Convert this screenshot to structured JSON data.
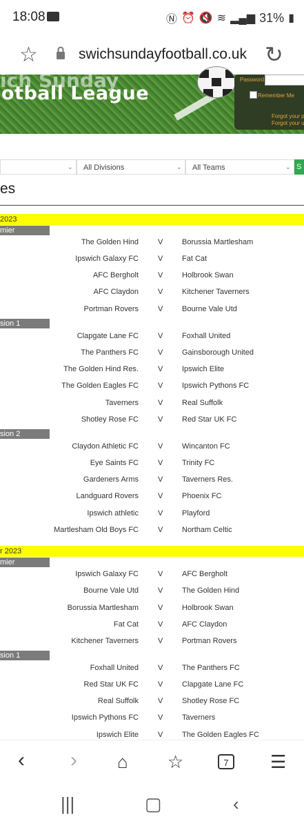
{
  "status_bar": {
    "time": "18:08",
    "battery": "31%"
  },
  "url_bar": {
    "url": "swichsundayfootball.co.uk"
  },
  "banner": {
    "title_top": "ich Sunday",
    "title": "otball League"
  },
  "login": {
    "password_label": "Password",
    "remember_label": "Remember Me",
    "forgot1": "Forgot your p",
    "forgot2": "Forgot your u"
  },
  "filters": {
    "divisions": "All Divisions",
    "teams": "All Teams",
    "go": "S"
  },
  "page_heading": "es",
  "sections": [
    {
      "date": "2023",
      "groups": [
        {
          "division": "mier",
          "fixtures": [
            {
              "home": "The Golden Hind",
              "away": "Borussia Martlesham"
            },
            {
              "home": "Ipswich Galaxy FC",
              "away": "Fat Cat"
            },
            {
              "home": "AFC Bergholt",
              "away": "Holbrook Swan"
            },
            {
              "home": "AFC Claydon",
              "away": "Kitchener Taverners"
            },
            {
              "home": "Portman Rovers",
              "away": "Bourne Vale Utd"
            }
          ]
        },
        {
          "division": "sion 1",
          "fixtures": [
            {
              "home": "Clapgate Lane FC",
              "away": "Foxhall United"
            },
            {
              "home": "The Panthers FC",
              "away": "Gainsborough United"
            },
            {
              "home": "The Golden Hind Res.",
              "away": "Ipswich Elite"
            },
            {
              "home": "The Golden Eagles FC",
              "away": "Ipswich Pythons FC"
            },
            {
              "home": "Taverners",
              "away": "Real Suffolk"
            },
            {
              "home": "Shotley Rose FC",
              "away": "Red Star UK FC"
            }
          ]
        },
        {
          "division": "sion 2",
          "fixtures": [
            {
              "home": "Claydon Athletic FC",
              "away": "Wincanton FC"
            },
            {
              "home": "Eye Saints FC",
              "away": "Trinity FC"
            },
            {
              "home": "Gardeners Arms",
              "away": "Taverners Res."
            },
            {
              "home": "Landguard Rovers",
              "away": "Phoenix FC"
            },
            {
              "home": "Ipswich athletic",
              "away": "Playford"
            },
            {
              "home": "Martlesham Old Boys FC",
              "away": "Northam Celtic"
            }
          ]
        }
      ]
    },
    {
      "date": "r 2023",
      "groups": [
        {
          "division": "mier",
          "fixtures": [
            {
              "home": "Ipswich Galaxy FC",
              "away": "AFC Bergholt"
            },
            {
              "home": "Bourne Vale Utd",
              "away": "The Golden Hind"
            },
            {
              "home": "Borussia Martlesham",
              "away": "Holbrook Swan"
            },
            {
              "home": "Fat Cat",
              "away": "AFC Claydon"
            },
            {
              "home": "Kitchener Taverners",
              "away": "Portman Rovers"
            }
          ]
        },
        {
          "division": "sion 1",
          "fixtures": [
            {
              "home": "Foxhall United",
              "away": "The Panthers FC"
            },
            {
              "home": "Red Star UK FC",
              "away": "Clapgate Lane FC"
            },
            {
              "home": "Real Suffolk",
              "away": "Shotley Rose FC"
            },
            {
              "home": "Ipswich Pythons FC",
              "away": "Taverners"
            },
            {
              "home": "Ipswich Elite",
              "away": "The Golden Eagles FC"
            }
          ]
        }
      ]
    }
  ],
  "versus": "V",
  "browser_nav": {
    "tabs_count": "7"
  }
}
